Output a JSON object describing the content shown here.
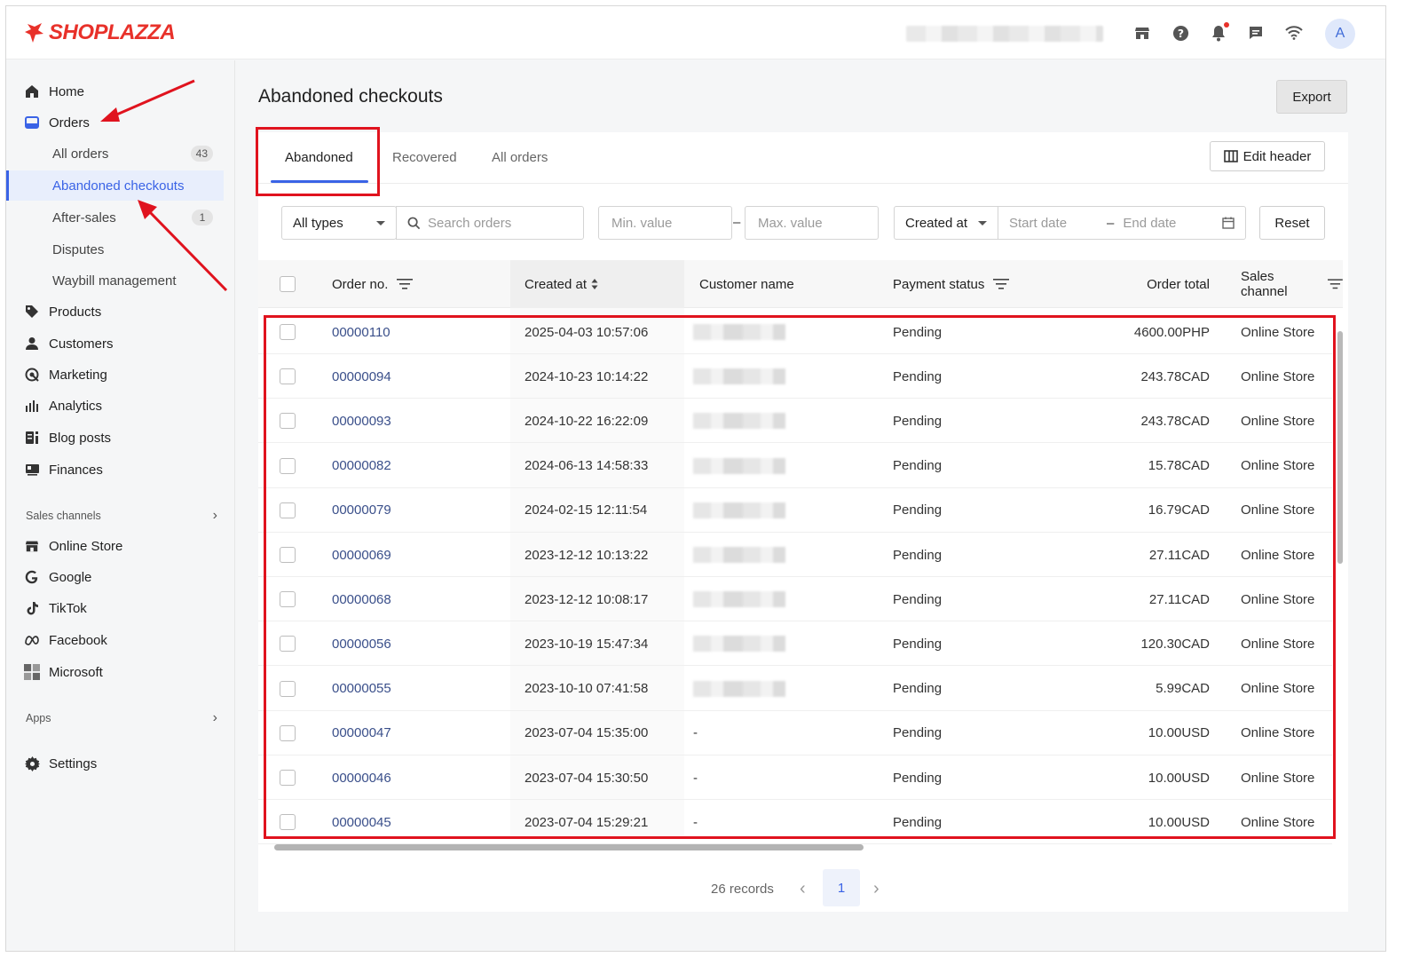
{
  "brand": {
    "name": "SHOPLAZZA",
    "color": "#e8312a"
  },
  "topbar": {
    "icons": [
      "store-icon",
      "help-icon",
      "bell-icon",
      "chat-icon",
      "wifi-icon"
    ],
    "avatar_letter": "A"
  },
  "sidebar": {
    "items": [
      {
        "label": "Home",
        "icon": "home-icon"
      },
      {
        "label": "Orders",
        "icon": "orders-icon"
      },
      {
        "label": "Products",
        "icon": "tag-icon"
      },
      {
        "label": "Customers",
        "icon": "person-icon"
      },
      {
        "label": "Marketing",
        "icon": "marketing-icon"
      },
      {
        "label": "Analytics",
        "icon": "bar-chart-icon"
      },
      {
        "label": "Blog posts",
        "icon": "blog-icon"
      },
      {
        "label": "Finances",
        "icon": "finance-icon"
      }
    ],
    "order_subitems": [
      {
        "label": "All orders",
        "badge": "43"
      },
      {
        "label": "Abandoned checkouts",
        "active": true
      },
      {
        "label": "After-sales",
        "badge": "1"
      },
      {
        "label": "Disputes"
      },
      {
        "label": "Waybill management"
      }
    ],
    "sales_channels_label": "Sales channels",
    "channels": [
      {
        "label": "Online Store",
        "icon": "store-icon"
      },
      {
        "label": "Google",
        "icon": "google-icon"
      },
      {
        "label": "TikTok",
        "icon": "tiktok-icon"
      },
      {
        "label": "Facebook",
        "icon": "meta-icon"
      },
      {
        "label": "Microsoft",
        "icon": "microsoft-icon"
      }
    ],
    "apps_label": "Apps",
    "settings_label": "Settings"
  },
  "page": {
    "title": "Abandoned checkouts",
    "export_label": "Export",
    "tabs": [
      "Abandoned",
      "Recovered",
      "All orders"
    ],
    "active_tab": "Abandoned",
    "edit_header_label": "Edit header"
  },
  "filters": {
    "type_select": "All types",
    "search_placeholder": "Search orders",
    "min_placeholder": "Min. value",
    "max_placeholder": "Max. value",
    "range_sep": "–",
    "date_select": "Created at",
    "start_placeholder": "Start date",
    "end_placeholder": "End date",
    "reset_label": "Reset"
  },
  "table": {
    "columns": [
      "Order no.",
      "Created at",
      "Customer name",
      "Payment status",
      "Order total",
      "Sales channel"
    ],
    "rows": [
      {
        "order": "00000110",
        "created": "2025-04-03 10:57:06",
        "customer": "",
        "status": "Pending",
        "total": "4600.00PHP",
        "channel": "Online Store"
      },
      {
        "order": "00000094",
        "created": "2024-10-23 10:14:22",
        "customer": "",
        "status": "Pending",
        "total": "243.78CAD",
        "channel": "Online Store"
      },
      {
        "order": "00000093",
        "created": "2024-10-22 16:22:09",
        "customer": "",
        "status": "Pending",
        "total": "243.78CAD",
        "channel": "Online Store"
      },
      {
        "order": "00000082",
        "created": "2024-06-13 14:58:33",
        "customer": "",
        "status": "Pending",
        "total": "15.78CAD",
        "channel": "Online Store"
      },
      {
        "order": "00000079",
        "created": "2024-02-15 12:11:54",
        "customer": "",
        "status": "Pending",
        "total": "16.79CAD",
        "channel": "Online Store"
      },
      {
        "order": "00000069",
        "created": "2023-12-12 10:13:22",
        "customer": "",
        "status": "Pending",
        "total": "27.11CAD",
        "channel": "Online Store"
      },
      {
        "order": "00000068",
        "created": "2023-12-12 10:08:17",
        "customer": "",
        "status": "Pending",
        "total": "27.11CAD",
        "channel": "Online Store"
      },
      {
        "order": "00000056",
        "created": "2023-10-19 15:47:34",
        "customer": "",
        "status": "Pending",
        "total": "120.30CAD",
        "channel": "Online Store"
      },
      {
        "order": "00000055",
        "created": "2023-10-10 07:41:58",
        "customer": "",
        "status": "Pending",
        "total": "5.99CAD",
        "channel": "Online Store"
      },
      {
        "order": "00000047",
        "created": "2023-07-04 15:35:00",
        "customer": "-",
        "status": "Pending",
        "total": "10.00USD",
        "channel": "Online Store"
      },
      {
        "order": "00000046",
        "created": "2023-07-04 15:30:50",
        "customer": "-",
        "status": "Pending",
        "total": "10.00USD",
        "channel": "Online Store"
      },
      {
        "order": "00000045",
        "created": "2023-07-04 15:29:21",
        "customer": "-",
        "status": "Pending",
        "total": "10.00USD",
        "channel": "Online Store"
      }
    ]
  },
  "pagination": {
    "records": "26 records",
    "current_page": "1"
  },
  "colors": {
    "accent": "#3a63e6",
    "annotation": "#e0131e"
  }
}
